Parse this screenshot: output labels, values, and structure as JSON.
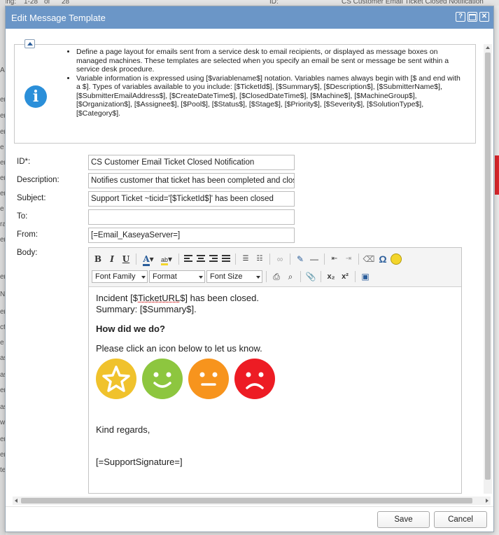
{
  "background": {
    "top_fragments": [
      "ving:",
      "1-28",
      "of",
      "28",
      "ID:",
      "CS Customer Email Ticket Closed Notification"
    ],
    "left_fragments": [
      "A",
      "er",
      "er",
      "er",
      "e",
      "er",
      "er",
      "er",
      "e",
      "ra",
      "er",
      "er",
      "er",
      "er",
      "e",
      "e",
      "N",
      "er",
      "e",
      "er",
      "er",
      "ct",
      "e",
      "as",
      "as",
      "er",
      "as",
      "w",
      "er",
      "er",
      "te"
    ]
  },
  "dialog": {
    "title": "Edit Message Template",
    "help_label": "?",
    "close_label": "✕",
    "info": {
      "items": [
        "Define a page layout for emails sent from a service desk to email recipients, or displayed as message boxes on managed machines. These templates are selected when you specify an email be sent or message be sent within a service desk procedure.",
        "Variable information is expressed using [$variablename$] notation. Variables names always begin with [$ and end with a $]. Types of variables available to you include: [$TicketId$], [$Summary$], [$Description$], [$SubmitterName$], [$SubmitterEmailAddress$], [$CreateDateTime$], [$ClosedDateTime$], [$Machine$], [$MachineGroup$], [$Organization$], [$Assignee$], [$Pool$], [$Status$], [$Stage$], [$Priority$], [$Severity$], [$SolutionType$], [$Category$]."
      ]
    },
    "form": {
      "id_label": "ID*:",
      "id_value": "CS Customer Email Ticket Closed Notification",
      "description_label": "Description:",
      "description_value": "Notifies customer that ticket has been completed and close",
      "subject_label": "Subject:",
      "subject_value": "Support Ticket ~ticid='[$TicketId$]' has been closed",
      "to_label": "To:",
      "to_value": "",
      "from_label": "From:",
      "from_value": "[=Email_KaseyaServer=]",
      "body_label": "Body:"
    },
    "editor": {
      "font_family": "Font Family",
      "format": "Format",
      "font_size": "Font Size",
      "omega": "Ω",
      "subscript": "x₂",
      "superscript": "x²",
      "content": {
        "line1_pre": "Incident [$",
        "line1_var": "TicketURL",
        "line1_post": "$] has been closed.",
        "line2": "Summary: [$Summary$].",
        "heading": "How did we do?",
        "prompt": "Please click an icon below to let us know.",
        "closing": "Kind regards,",
        "signature": "[=SupportSignature=]"
      },
      "faces": [
        {
          "name": "star",
          "color": "#f0c22c"
        },
        {
          "name": "happy",
          "color": "#8dc63f"
        },
        {
          "name": "neutral",
          "color": "#f7941d"
        },
        {
          "name": "sad",
          "color": "#ed1c24"
        }
      ]
    },
    "footer": {
      "save_label": "Save",
      "cancel_label": "Cancel"
    }
  }
}
